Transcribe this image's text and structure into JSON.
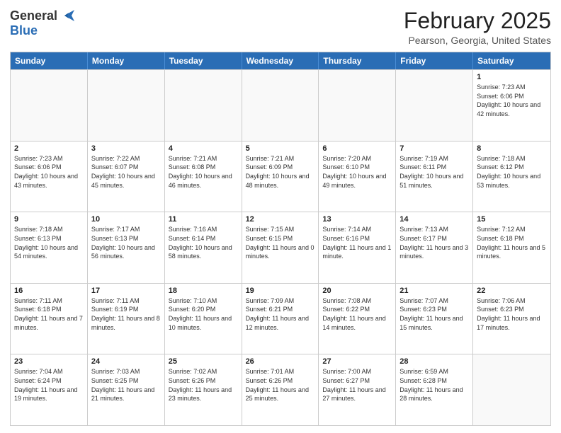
{
  "header": {
    "logo_line1": "General",
    "logo_line2": "Blue",
    "month_title": "February 2025",
    "location": "Pearson, Georgia, United States"
  },
  "days_of_week": [
    "Sunday",
    "Monday",
    "Tuesday",
    "Wednesday",
    "Thursday",
    "Friday",
    "Saturday"
  ],
  "weeks": [
    [
      {
        "day": "",
        "info": ""
      },
      {
        "day": "",
        "info": ""
      },
      {
        "day": "",
        "info": ""
      },
      {
        "day": "",
        "info": ""
      },
      {
        "day": "",
        "info": ""
      },
      {
        "day": "",
        "info": ""
      },
      {
        "day": "1",
        "info": "Sunrise: 7:23 AM\nSunset: 6:06 PM\nDaylight: 10 hours and 42 minutes."
      }
    ],
    [
      {
        "day": "2",
        "info": "Sunrise: 7:23 AM\nSunset: 6:06 PM\nDaylight: 10 hours and 43 minutes."
      },
      {
        "day": "3",
        "info": "Sunrise: 7:22 AM\nSunset: 6:07 PM\nDaylight: 10 hours and 45 minutes."
      },
      {
        "day": "4",
        "info": "Sunrise: 7:21 AM\nSunset: 6:08 PM\nDaylight: 10 hours and 46 minutes."
      },
      {
        "day": "5",
        "info": "Sunrise: 7:21 AM\nSunset: 6:09 PM\nDaylight: 10 hours and 48 minutes."
      },
      {
        "day": "6",
        "info": "Sunrise: 7:20 AM\nSunset: 6:10 PM\nDaylight: 10 hours and 49 minutes."
      },
      {
        "day": "7",
        "info": "Sunrise: 7:19 AM\nSunset: 6:11 PM\nDaylight: 10 hours and 51 minutes."
      },
      {
        "day": "8",
        "info": "Sunrise: 7:18 AM\nSunset: 6:12 PM\nDaylight: 10 hours and 53 minutes."
      }
    ],
    [
      {
        "day": "9",
        "info": "Sunrise: 7:18 AM\nSunset: 6:13 PM\nDaylight: 10 hours and 54 minutes."
      },
      {
        "day": "10",
        "info": "Sunrise: 7:17 AM\nSunset: 6:13 PM\nDaylight: 10 hours and 56 minutes."
      },
      {
        "day": "11",
        "info": "Sunrise: 7:16 AM\nSunset: 6:14 PM\nDaylight: 10 hours and 58 minutes."
      },
      {
        "day": "12",
        "info": "Sunrise: 7:15 AM\nSunset: 6:15 PM\nDaylight: 11 hours and 0 minutes."
      },
      {
        "day": "13",
        "info": "Sunrise: 7:14 AM\nSunset: 6:16 PM\nDaylight: 11 hours and 1 minute."
      },
      {
        "day": "14",
        "info": "Sunrise: 7:13 AM\nSunset: 6:17 PM\nDaylight: 11 hours and 3 minutes."
      },
      {
        "day": "15",
        "info": "Sunrise: 7:12 AM\nSunset: 6:18 PM\nDaylight: 11 hours and 5 minutes."
      }
    ],
    [
      {
        "day": "16",
        "info": "Sunrise: 7:11 AM\nSunset: 6:18 PM\nDaylight: 11 hours and 7 minutes."
      },
      {
        "day": "17",
        "info": "Sunrise: 7:11 AM\nSunset: 6:19 PM\nDaylight: 11 hours and 8 minutes."
      },
      {
        "day": "18",
        "info": "Sunrise: 7:10 AM\nSunset: 6:20 PM\nDaylight: 11 hours and 10 minutes."
      },
      {
        "day": "19",
        "info": "Sunrise: 7:09 AM\nSunset: 6:21 PM\nDaylight: 11 hours and 12 minutes."
      },
      {
        "day": "20",
        "info": "Sunrise: 7:08 AM\nSunset: 6:22 PM\nDaylight: 11 hours and 14 minutes."
      },
      {
        "day": "21",
        "info": "Sunrise: 7:07 AM\nSunset: 6:23 PM\nDaylight: 11 hours and 15 minutes."
      },
      {
        "day": "22",
        "info": "Sunrise: 7:06 AM\nSunset: 6:23 PM\nDaylight: 11 hours and 17 minutes."
      }
    ],
    [
      {
        "day": "23",
        "info": "Sunrise: 7:04 AM\nSunset: 6:24 PM\nDaylight: 11 hours and 19 minutes."
      },
      {
        "day": "24",
        "info": "Sunrise: 7:03 AM\nSunset: 6:25 PM\nDaylight: 11 hours and 21 minutes."
      },
      {
        "day": "25",
        "info": "Sunrise: 7:02 AM\nSunset: 6:26 PM\nDaylight: 11 hours and 23 minutes."
      },
      {
        "day": "26",
        "info": "Sunrise: 7:01 AM\nSunset: 6:26 PM\nDaylight: 11 hours and 25 minutes."
      },
      {
        "day": "27",
        "info": "Sunrise: 7:00 AM\nSunset: 6:27 PM\nDaylight: 11 hours and 27 minutes."
      },
      {
        "day": "28",
        "info": "Sunrise: 6:59 AM\nSunset: 6:28 PM\nDaylight: 11 hours and 28 minutes."
      },
      {
        "day": "",
        "info": ""
      }
    ]
  ]
}
